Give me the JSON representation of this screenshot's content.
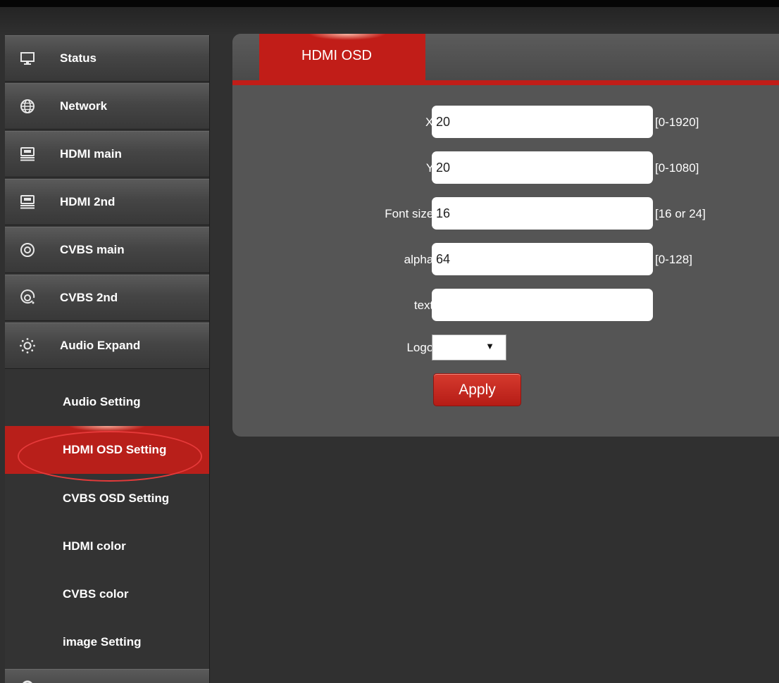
{
  "sidebar": {
    "items": [
      {
        "label": "Status",
        "icon": "monitor-icon"
      },
      {
        "label": "Network",
        "icon": "globe-icon"
      },
      {
        "label": "HDMI main",
        "icon": "hdmi-icon"
      },
      {
        "label": "HDMI 2nd",
        "icon": "hdmi-icon"
      },
      {
        "label": "CVBS main",
        "icon": "cvbs-icon"
      },
      {
        "label": "CVBS 2nd",
        "icon": "cvbs-icon"
      },
      {
        "label": "Audio Expand",
        "icon": "gear-icon"
      }
    ],
    "submenu": [
      {
        "label": "Audio Setting"
      },
      {
        "label": "HDMI OSD Setting",
        "active": true
      },
      {
        "label": "CVBS OSD Setting"
      },
      {
        "label": "HDMI color"
      },
      {
        "label": "CVBS color"
      },
      {
        "label": "image Setting"
      }
    ]
  },
  "panel": {
    "tab_label": "HDMI OSD",
    "fields": {
      "x": {
        "label": "X:",
        "value": "20",
        "range": "[0-1920]"
      },
      "y": {
        "label": "Y:",
        "value": "20",
        "range": "[0-1080]"
      },
      "font_size": {
        "label": "Font size:",
        "value": "16",
        "range": "[16 or 24]"
      },
      "alpha": {
        "label": "alpha:",
        "value": "64",
        "range": "[0-128]"
      },
      "text": {
        "label": "text:",
        "value": ""
      }
    },
    "logo": {
      "label": "Logo:",
      "selected": ""
    },
    "apply_label": "Apply"
  },
  "colors": {
    "accent": "#c11d18",
    "panel": "#555555",
    "background": "#303030"
  }
}
